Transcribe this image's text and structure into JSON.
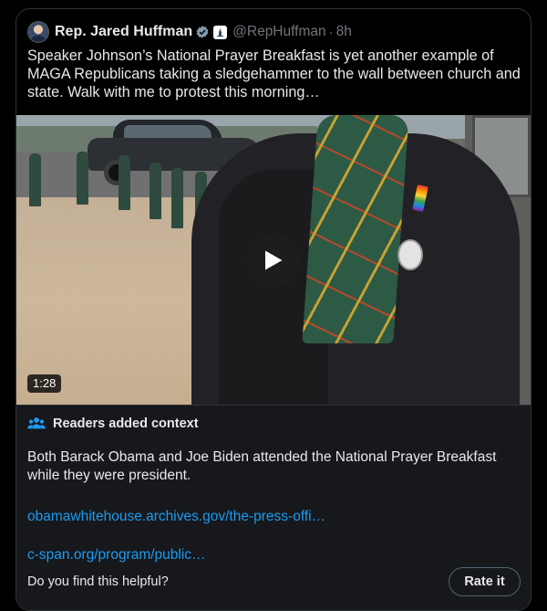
{
  "tweet": {
    "display_name": "Rep. Jared Huffman",
    "handle": "@RepHuffman",
    "separator": "·",
    "time": "8h",
    "text": "Speaker Johnson’s National Prayer Breakfast is yet another example of MAGA Republicans taking a sledgehammer to the wall between church and state. Walk with me to protest this morning…",
    "icons": {
      "avatar": "profile-avatar",
      "verified": "verified-badge-icon",
      "affiliation": "government-affiliation-icon"
    }
  },
  "video": {
    "duration": "1:28",
    "play_icon": "play-icon"
  },
  "community_note": {
    "title": "Readers added context",
    "icon": "people-icon",
    "body": "Both Barack Obama and Joe Biden attended the National Prayer Breakfast while they were president.",
    "links": [
      "obamawhitehouse.archives.gov/the-press-offi…",
      "c-span.org/program/public…"
    ],
    "helpful_prompt": "Do you find this helpful?",
    "rate_label": "Rate it"
  },
  "colors": {
    "background": "#000000",
    "note_background": "#16181c",
    "link": "#1d9bf0",
    "muted": "#71767b",
    "verified": "#829aab"
  }
}
